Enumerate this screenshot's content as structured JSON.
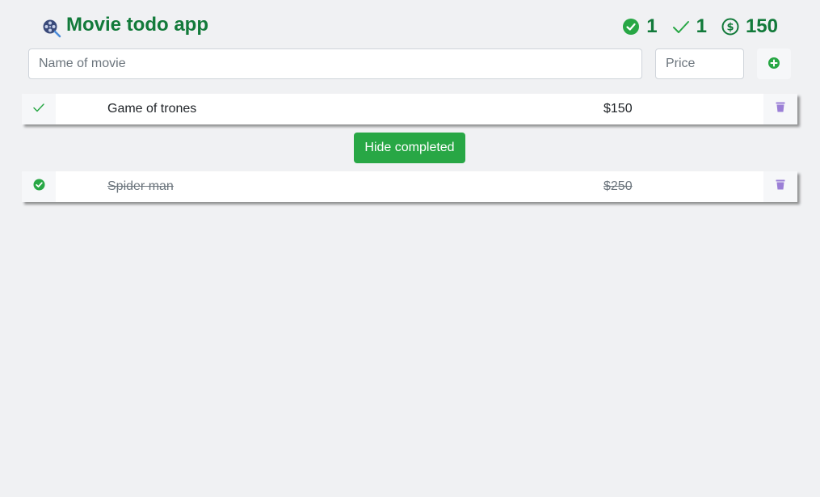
{
  "header": {
    "title": "Movie todo app",
    "logo_icon": "film-reel-search-icon",
    "stats": [
      {
        "icon": "check-circle-icon",
        "value": "1"
      },
      {
        "icon": "check-icon",
        "value": "1"
      },
      {
        "icon": "dollar-circle-icon",
        "value": "150"
      }
    ]
  },
  "form": {
    "name_placeholder": "Name of movie",
    "name_value": "",
    "price_placeholder": "Price",
    "price_value": "",
    "add_icon": "plus-circle-icon"
  },
  "todos": [
    {
      "name": "Game of trones",
      "price": "$150",
      "completed": false
    },
    {
      "name": "Spider man",
      "price": "$250",
      "completed": true
    }
  ],
  "hide_completed_label": "Hide completed",
  "colors": {
    "background": "#f0f1f3",
    "brand_green": "#127a3a",
    "button_green": "#28a745",
    "trash_purple": "#9b7fd6"
  }
}
